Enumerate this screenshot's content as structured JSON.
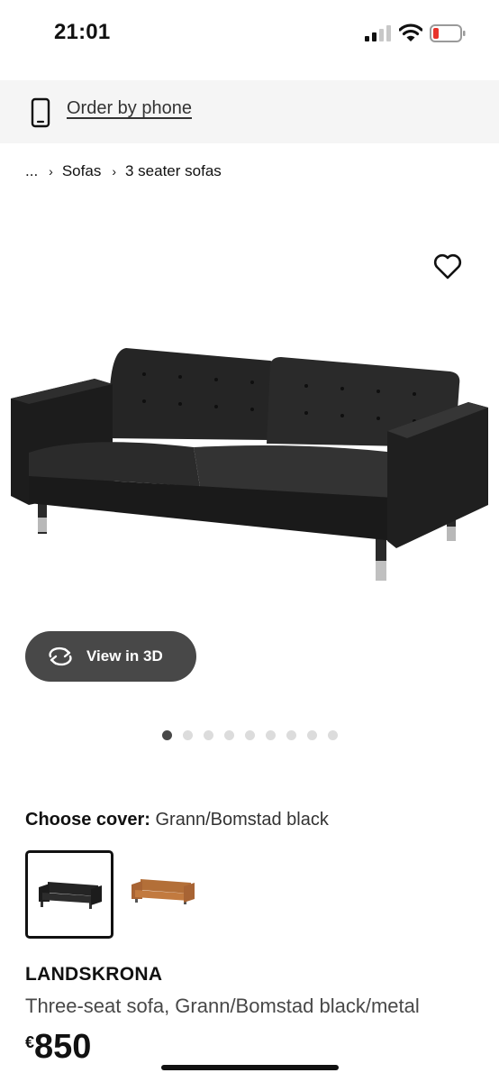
{
  "status_bar": {
    "time": "21:01"
  },
  "order_by_phone": {
    "label": "Order by phone"
  },
  "breadcrumb": {
    "items": [
      "...",
      "Sofas",
      "3 seater sofas"
    ]
  },
  "gallery": {
    "view_3d_label": "View in 3D",
    "dots_count": 9,
    "active_index": 0
  },
  "cover": {
    "label": "Choose cover:",
    "value": "Grann/Bomstad black",
    "swatches": [
      "Grann/Bomstad black",
      "Grann/Bomstad golden-brown"
    ]
  },
  "product": {
    "name": "LANDSKRONA",
    "description": "Three-seat sofa, Grann/Bomstad black/metal",
    "price_currency": "€",
    "price_amount": "850"
  },
  "colors": {
    "banner_bg": "#f5f5f5",
    "button_dark": "#484848",
    "sofa_black": "#1e1e1e",
    "sofa_brown": "#c27a3f"
  }
}
